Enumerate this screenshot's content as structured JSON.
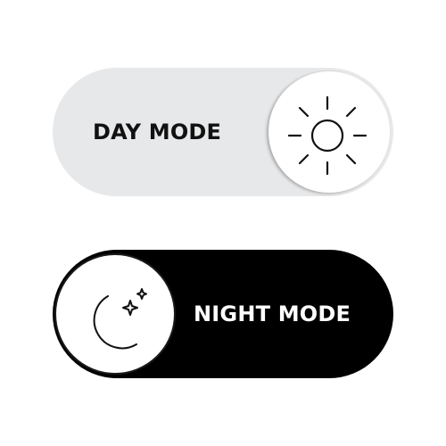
{
  "toggles": {
    "day": {
      "label": "DAY MODE",
      "icon": "sun-icon",
      "track_color": "#e7e8e9",
      "text_color": "#111111"
    },
    "night": {
      "label": "NIGHT MODE",
      "icon": "moon-stars-icon",
      "track_color": "#000000",
      "text_color": "#ffffff"
    }
  }
}
